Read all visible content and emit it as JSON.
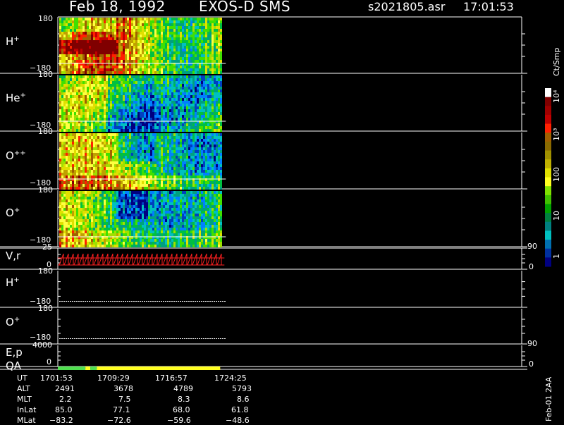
{
  "header": {
    "date": "Feb 18, 1992",
    "instrument": "EXOS-D SMS",
    "file": "s2021805.asr",
    "time": "17:01:53"
  },
  "panels": [
    {
      "id": "h_plus_sp",
      "label": "H",
      "sup": "+",
      "top_tick": "180",
      "bottom_tick": "−180"
    },
    {
      "id": "he_plus_sp",
      "label": "He",
      "sup": "+",
      "top_tick": "180",
      "bottom_tick": "−180"
    },
    {
      "id": "o_pp_sp",
      "label": "O",
      "sup": "++",
      "top_tick": "180",
      "bottom_tick": "−180"
    },
    {
      "id": "o_plus_sp",
      "label": "O",
      "sup": "+",
      "top_tick": "180",
      "bottom_tick": "−180"
    },
    {
      "id": "vr",
      "label": "V,r",
      "sup": "",
      "top_tick": "25",
      "bottom_tick": "0",
      "right_top": "90",
      "right_bottom": "0"
    },
    {
      "id": "h_plus_line",
      "label": "H",
      "sup": "+",
      "top_tick": "180",
      "bottom_tick": "−180"
    },
    {
      "id": "o_plus_line",
      "label": "O",
      "sup": "+",
      "top_tick": "180",
      "bottom_tick": "−180"
    },
    {
      "id": "ep",
      "label": "E,p",
      "sup": "",
      "top_tick": "4000",
      "bottom_tick": "0",
      "right_top": "90",
      "right_bottom": "0"
    },
    {
      "id": "qa",
      "label": "QA",
      "sup": ""
    }
  ],
  "colorbar": {
    "unit": "Ct/Smp",
    "ticks": [
      "10⁴",
      "10³",
      "100",
      "10",
      "1"
    ]
  },
  "ut_table": {
    "row_labels": [
      "UT",
      "ALT",
      "MLT",
      "InLat",
      "MLat"
    ],
    "columns": [
      [
        "1701:53",
        "2491",
        "2.2",
        "85.0",
        "−83.2"
      ],
      [
        "1709:29",
        "3678",
        "7.5",
        "77.1",
        "−72.6"
      ],
      [
        "1716:57",
        "4789",
        "8.3",
        "68.0",
        "−59.6"
      ],
      [
        "1724:25",
        "5793",
        "8.6",
        "61.8",
        "−48.6"
      ]
    ]
  },
  "footer_note": "Feb-01 2AA",
  "chart_data": {
    "type": "heatmap",
    "title": "Feb 18, 1992   EXOS-D SMS",
    "time_axis": [
      "1701:53",
      "1709:29",
      "1716:57",
      "1724:25"
    ],
    "pitch_angle_range": [
      -180,
      180
    ],
    "colorbar_range": [
      1,
      10000
    ],
    "colorbar_scale": "log",
    "data_coverage_fraction": 0.35,
    "species": [
      "H+",
      "He+",
      "O++",
      "O+"
    ],
    "qa_segments": [
      {
        "color": "#50e050",
        "fraction": 0.17
      },
      {
        "color": "#ffff20",
        "fraction": 0.03
      },
      {
        "color": "#50e050",
        "fraction": 0.04
      },
      {
        "color": "#ffff20",
        "fraction": 0.76
      }
    ]
  }
}
